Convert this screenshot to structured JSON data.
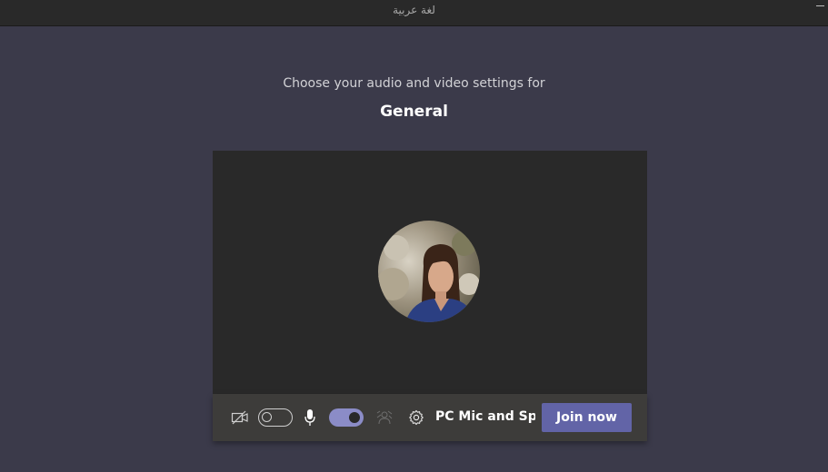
{
  "window": {
    "title": "لغة عربية"
  },
  "prejoin": {
    "prompt": "Choose your audio and video settings for",
    "meeting_name": "General"
  },
  "controls": {
    "camera_toggle_on": false,
    "mic_toggle_on": true,
    "device_label": "PC Mic and Sp...",
    "join_label": "Join now"
  },
  "icons": {
    "camera": "camera-off-icon",
    "mic": "microphone-icon",
    "blur": "background-blur-icon",
    "settings": "gear-icon"
  },
  "colors": {
    "accent": "#6264a7",
    "toggle_on": "#8b8cc7",
    "background": "#3b3a4a"
  }
}
